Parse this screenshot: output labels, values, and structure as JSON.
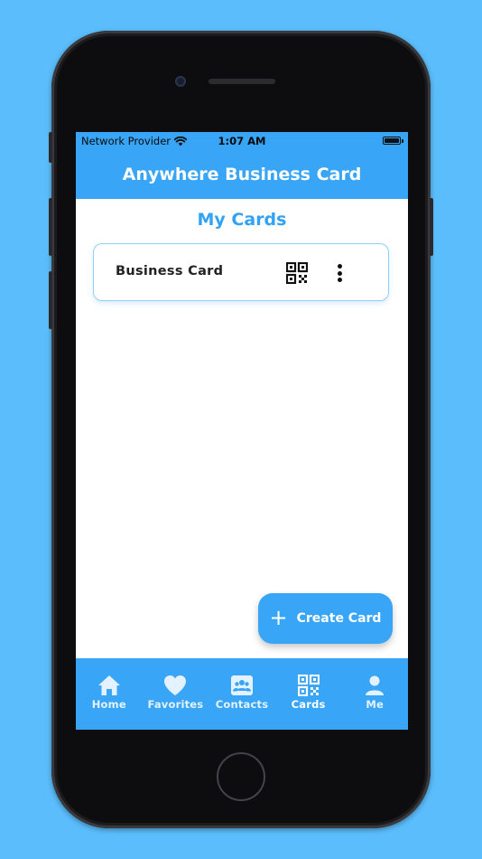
{
  "status_bar": {
    "carrier": "Network Provider",
    "time": "1:07 AM"
  },
  "header": {
    "title": "Anywhere Business Card"
  },
  "main": {
    "section_title": "My Cards",
    "cards": [
      {
        "name": "Business Card",
        "icon": "qr-code-icon",
        "menu_icon": "more-vertical-icon"
      }
    ]
  },
  "fab": {
    "label": "Create Card",
    "icon": "plus-icon"
  },
  "bottom_nav": {
    "items": [
      {
        "label": "Home",
        "icon": "home-icon"
      },
      {
        "label": "Favorites",
        "icon": "heart-icon"
      },
      {
        "label": "Contacts",
        "icon": "contacts-icon"
      },
      {
        "label": "Cards",
        "icon": "qr-code-icon",
        "active": true
      },
      {
        "label": "Me",
        "icon": "person-icon"
      }
    ]
  },
  "colors": {
    "primary": "#39a5f6",
    "accent_text": "#33a2f4",
    "background": "#5bbdfb",
    "nav_inactive": "#e3f2fe"
  }
}
